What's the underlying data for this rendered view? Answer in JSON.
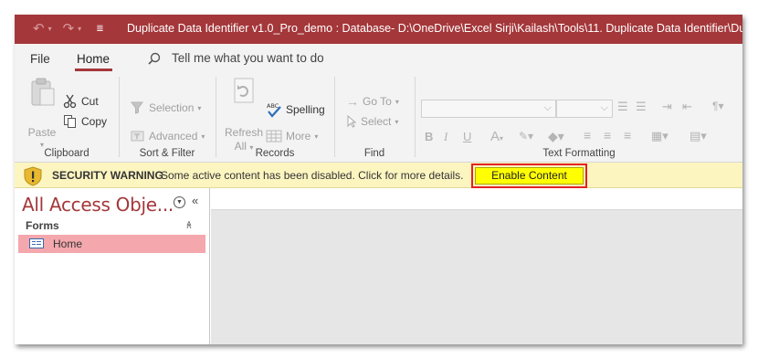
{
  "window": {
    "title": "Duplicate Data Identifier v1.0_Pro_demo : Database- D:\\OneDrive\\Excel Sirji\\Kailash\\Tools\\11. Duplicate Data Identifier\\Duplicate",
    "titlebar_color": "#a4373a"
  },
  "qat": {
    "undo_icon": "undo-icon",
    "redo_icon": "redo-icon",
    "customize_icon": "customize-qat-icon"
  },
  "tabs": {
    "file": "File",
    "home": "Home"
  },
  "tellme": {
    "icon": "search-icon",
    "text": "Tell me what you want to do"
  },
  "ribbon": {
    "clipboard": {
      "label": "Clipboard",
      "paste": "Paste",
      "cut": "Cut",
      "copy": "Copy"
    },
    "sort_filter": {
      "label": "Sort & Filter",
      "selection": "Selection",
      "advanced": "Advanced"
    },
    "records": {
      "label": "Records",
      "refresh": "Refresh",
      "all": "All",
      "spelling": "Spelling",
      "more": "More"
    },
    "find": {
      "label": "Find",
      "goto": "Go To",
      "select": "Select"
    },
    "text_formatting": {
      "label": "Text Formatting",
      "bold": "B",
      "italic": "I",
      "underline": "U",
      "font_color": "A"
    }
  },
  "security": {
    "title": "SECURITY WARNING",
    "message": "Some active content has been disabled. Click for more details.",
    "button": "Enable Content",
    "bar_color": "#fdf5c0",
    "highlight_color": "#e32222"
  },
  "nav": {
    "title": "All Access Obje...",
    "group": "Forms",
    "items": [
      {
        "label": "Home",
        "icon": "form-icon"
      }
    ],
    "selected_color": "#f4a8ad"
  }
}
